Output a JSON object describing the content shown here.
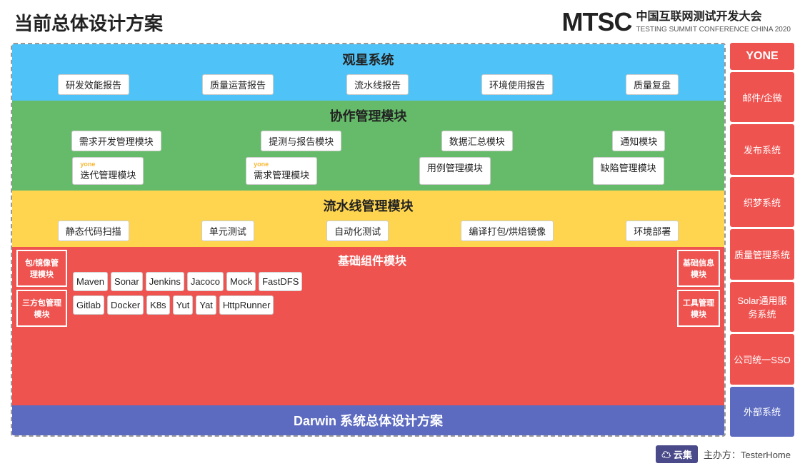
{
  "header": {
    "title": "当前总体设计方案",
    "logo_mtsc": "MTSC",
    "logo_china": "中国互联网测试开发大会",
    "logo_sub": "TESTING SUMMIT CONFERENCE CHINA 2020"
  },
  "layers": {
    "guanxing": {
      "title": "观星系统",
      "items": [
        "研发效能报告",
        "质量运营报告",
        "流水线报告",
        "环境使用报告",
        "质量复盘"
      ]
    },
    "xiezuo": {
      "title": "协作管理模块",
      "row1": [
        "需求开发管理模块",
        "提测与报告模块",
        "数据汇总模块",
        "通知模块"
      ],
      "row2_label1": "yone",
      "row2_item1": "迭代管理模块",
      "row2_label2": "yone",
      "row2_item2": "需求管理模块",
      "row2_item3": "用例管理模块",
      "row2_item4": "缺陷管理模块"
    },
    "liushui": {
      "title": "流水线管理模块",
      "items": [
        "静态代码扫描",
        "单元测试",
        "自动化测试",
        "编译打包/烘焙镜像",
        "环境部署"
      ]
    },
    "jichu": {
      "left_top": "包/镜像管\n理模块",
      "left_bottom": "三方包管理\n模块",
      "title": "基础组件模块",
      "tools_row1": [
        "Maven",
        "Sonar",
        "Jenkins",
        "Jacoco",
        "Mock",
        "FastDFS"
      ],
      "tools_row2": [
        "Gitlab",
        "Docker",
        "K8s",
        "Yut",
        "Yat",
        "HttpRunner"
      ],
      "right_top": "基础信息\n模块",
      "right_bottom": "工具管理\n模块"
    },
    "darwin": {
      "text": "Darwin 系统总体设计方案"
    }
  },
  "sidebar": {
    "header": "YONE",
    "items": [
      "邮件/企微",
      "发布系统",
      "织梦系统",
      "质量管理系统",
      "Solar通用服务系统",
      "公司统一SSO",
      "外部系统"
    ]
  },
  "footer": {
    "yunji": "云集",
    "host": "主办方：TesterHome"
  }
}
